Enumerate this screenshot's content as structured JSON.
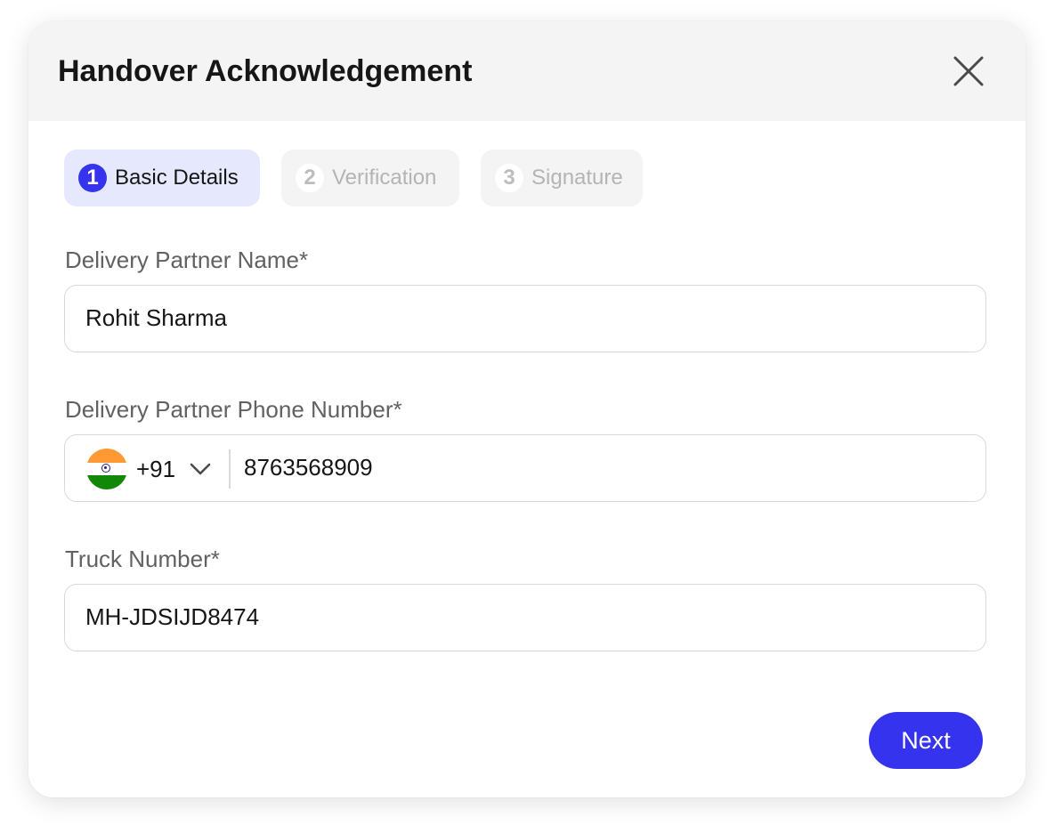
{
  "modal": {
    "title": "Handover Acknowledgement",
    "close_icon": "close-icon"
  },
  "steps": [
    {
      "number": "1",
      "label": "Basic Details",
      "active": true
    },
    {
      "number": "2",
      "label": "Verification",
      "active": false
    },
    {
      "number": "3",
      "label": "Signature",
      "active": false
    }
  ],
  "form": {
    "name": {
      "label": "Delivery Partner Name*",
      "value": "Rohit Sharma"
    },
    "phone": {
      "label": "Delivery Partner Phone Number*",
      "country_flag_icon": "india-flag-icon",
      "dial_code": "+91",
      "dropdown_icon": "chevron-down-icon",
      "value": "8763568909"
    },
    "truck": {
      "label": "Truck Number*",
      "value": "MH-JDSIJD8474"
    }
  },
  "actions": {
    "next_label": "Next"
  },
  "colors": {
    "accent": "#3633EE",
    "active_step_bg": "#E6E8FD",
    "header_bg": "#F4F4F4",
    "input_border": "#D9D9D9"
  }
}
